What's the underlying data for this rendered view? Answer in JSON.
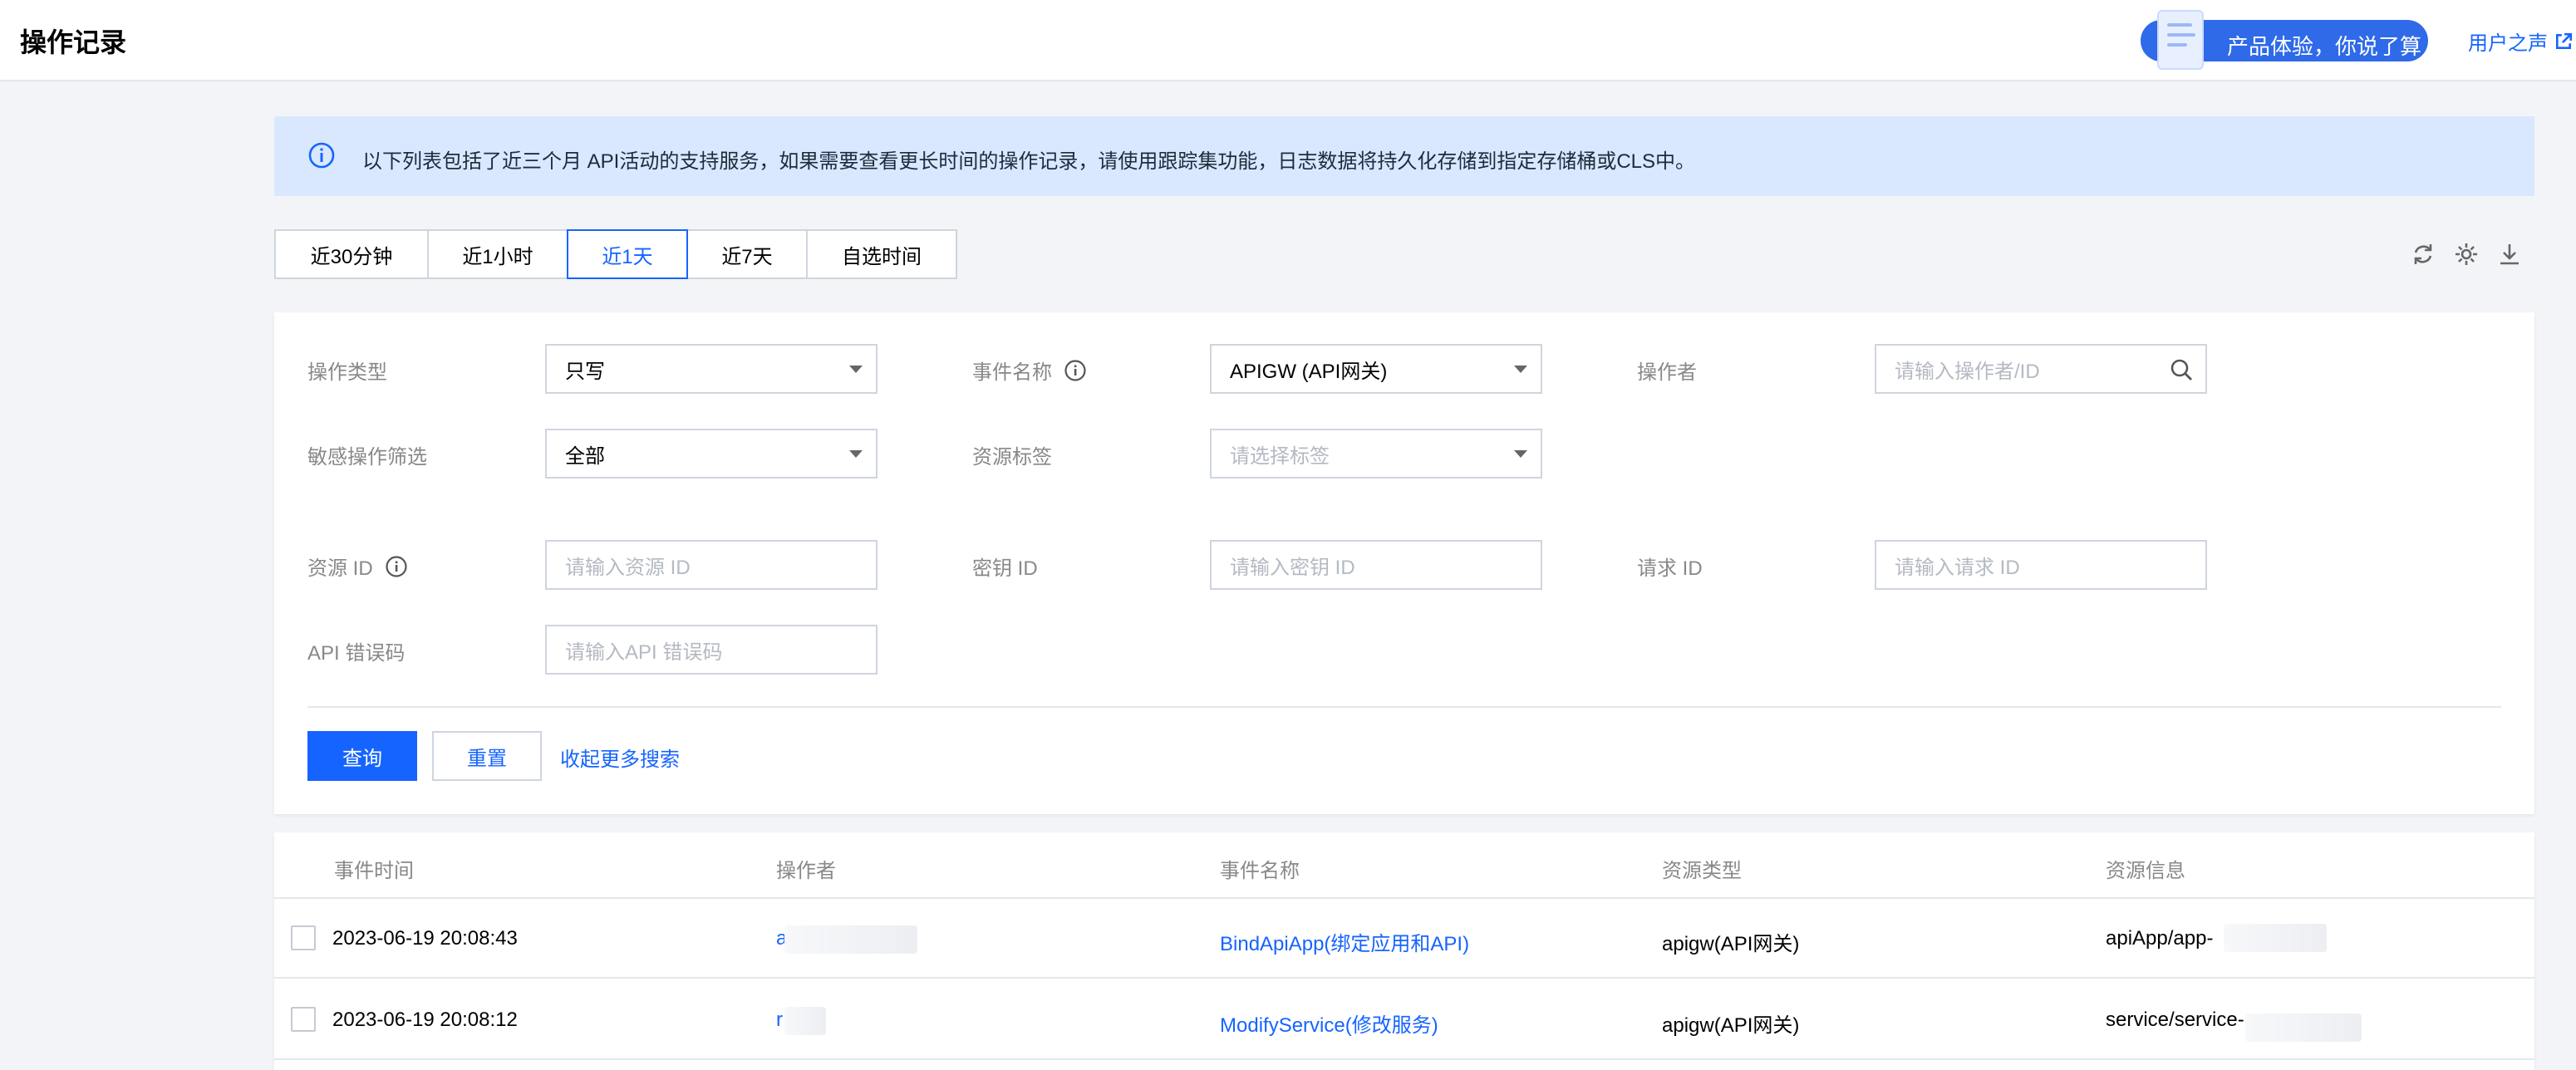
{
  "header": {
    "title": "操作记录",
    "feedback_label": "产品体验，你说了算",
    "voice_link": "用户之声"
  },
  "banner": {
    "text": "以下列表包括了近三个月 API活动的支持服务，如果需要查看更长时间的操作记录，请使用跟踪集功能，日志数据将持久化存储到指定存储桶或CLS中。"
  },
  "time_tabs": [
    {
      "label": "近30分钟",
      "active": false
    },
    {
      "label": "近1小时",
      "active": false
    },
    {
      "label": "近1天",
      "active": true
    },
    {
      "label": "近7天",
      "active": false
    },
    {
      "label": "自选时间",
      "active": false
    }
  ],
  "toolbar_icons": [
    "refresh-icon",
    "settings-icon",
    "download-icon"
  ],
  "filters": {
    "op_type_label": "操作类型",
    "op_type_value": "只写",
    "event_name_label": "事件名称",
    "event_name_value": "APIGW (API网关)",
    "operator_label": "操作者",
    "operator_placeholder": "请输入操作者/ID",
    "sensitive_label": "敏感操作筛选",
    "sensitive_value": "全部",
    "resource_tag_label": "资源标签",
    "resource_tag_placeholder": "请选择标签",
    "resource_id_label": "资源 ID",
    "resource_id_placeholder": "请输入资源 ID",
    "secret_id_label": "密钥 ID",
    "secret_id_placeholder": "请输入密钥 ID",
    "request_id_label": "请求 ID",
    "request_id_placeholder": "请输入请求 ID",
    "api_error_label": "API 错误码",
    "api_error_placeholder": "请输入API 错误码"
  },
  "actions": {
    "query": "查询",
    "reset": "重置",
    "collapse": "收起更多搜索"
  },
  "table": {
    "columns": [
      "事件时间",
      "操作者",
      "事件名称",
      "资源类型",
      "资源信息"
    ],
    "rows": [
      {
        "time": "2023-06-19 20:08:43",
        "operator": "a",
        "event": "BindApiApp(绑定应用和API)",
        "resource_type": "apigw(API网关)",
        "resource_info": "apiApp/app-"
      },
      {
        "time": "2023-06-19 20:08:12",
        "operator": "r",
        "event": "ModifyService(修改服务)",
        "resource_type": "apigw(API网关)",
        "resource_info": "service/service-"
      }
    ]
  },
  "colors": {
    "accent": "#1664ff",
    "banner_bg": "#d9e8ff",
    "page_bg": "#f3f4f7"
  }
}
